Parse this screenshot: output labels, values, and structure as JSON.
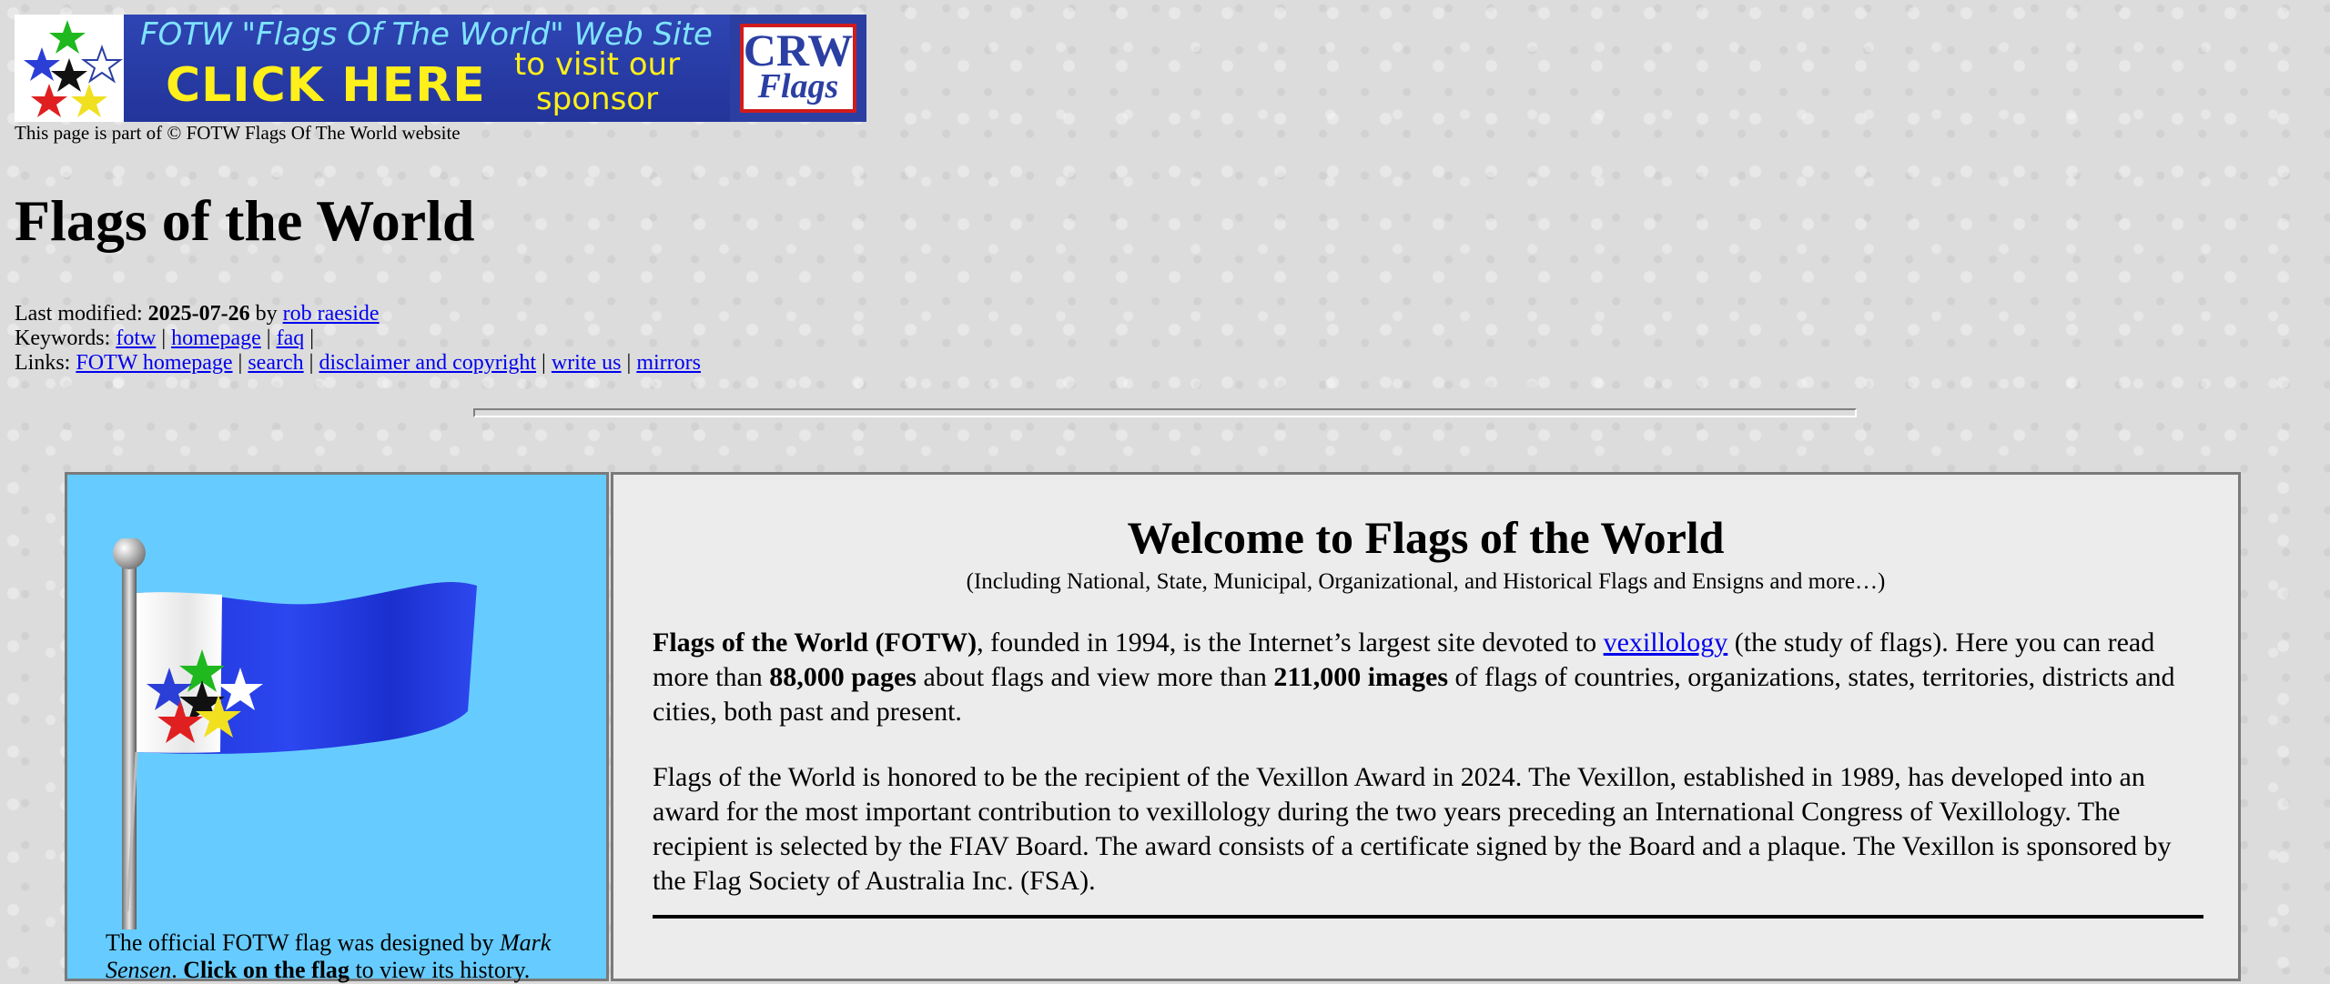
{
  "banner": {
    "title": "FOTW \"Flags Of The World\" Web Site",
    "click_here": "CLICK HERE",
    "visit": "to visit our sponsor",
    "sponsor_top": "CRW",
    "sponsor_bottom": "Flags"
  },
  "part_of": "This page is part of © FOTW Flags Of The World website",
  "page_title": "Flags of the World",
  "meta": {
    "last_modified_label": "Last modified: ",
    "last_modified_date": "2025-07-26",
    "by": " by ",
    "author": "rob raeside",
    "keywords_label": "Keywords: ",
    "keywords": [
      "fotw",
      "homepage",
      "faq"
    ],
    "links_label": "Links: ",
    "links": [
      "FOTW homepage",
      "search",
      "disclaimer and copyright",
      "write us",
      "mirrors"
    ],
    "separator": " | "
  },
  "left_panel": {
    "caption_start": "The official FOTW flag was designed by ",
    "designer": "Mark Sensen",
    "caption_mid": ". ",
    "caption_bold": "Click on the flag",
    "caption_end": " to view its history."
  },
  "welcome": {
    "title": "Welcome to Flags of the World",
    "subtitle": "(Including National, State, Municipal, Organizational, and Historical Flags and Ensigns and more…)",
    "p1_bold": "Flags of the World (FOTW)",
    "p1_a": ", founded in 1994, is the Internet’s largest site devoted to ",
    "p1_link": "vexillology",
    "p1_b": " (the study of flags). Here you can read more than ",
    "p1_bold2": "88,000 pages",
    "p1_c": " about flags and view more than ",
    "p1_bold3": "211,000 images",
    "p1_d": " of flags of countries, organizations, states, territories, districts and cities, both past and present.",
    "p2": "Flags of the World is honored to be the recipient of the Vexillon Award in 2024. The Vexillon, established in 1989, has developed into an award for the most important contribution to vexillology during the two years preceding an International Congress of Vexillology. The recipient is selected by the FIAV Board. The award consists of a certificate signed by the Board and a plaque. The Vexillon is sponsored by the Flag Society of Australia Inc. (FSA)."
  },
  "colors": {
    "link": "#0000ee",
    "panel_blue": "#66ccff",
    "flag_blue": "#1a2fd6",
    "banner_blue": "#2b3fa3",
    "banner_yellow": "#ffef1a"
  }
}
